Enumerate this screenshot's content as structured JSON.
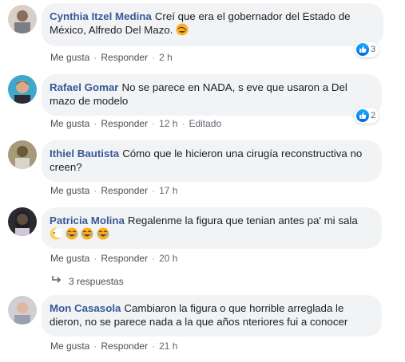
{
  "comments": [
    {
      "author": "Cynthia Itzel Medina",
      "text": "Creí que era el gobernador del Estado de México, Alfredo Del Mazo.",
      "like_label": "Me gusta",
      "reply_label": "Responder",
      "time": "2 h",
      "reaction_count": "3",
      "emojis": [
        "rofl-emoji"
      ]
    },
    {
      "author": "Rafael Gomar",
      "text": "No se parece en NADA, s eve que usaron a Del mazo de modelo",
      "like_label": "Me gusta",
      "reply_label": "Responder",
      "time": "12 h",
      "edited": "Editado",
      "reaction_count": "2"
    },
    {
      "author": "Ithiel Bautista",
      "text": "Cómo que le hicieron una cirugía reconstructiva no creen?",
      "like_label": "Me gusta",
      "reply_label": "Responder",
      "time": "17 h"
    },
    {
      "author": "Patricia Molina",
      "text": "Regalenme la figura que tenian antes pa' mi sala",
      "like_label": "Me gusta",
      "reply_label": "Responder",
      "time": "20 h",
      "emojis": [
        "moon-face-emoji",
        "joy-emoji",
        "joy-emoji",
        "joy-emoji"
      ]
    },
    {
      "author": "Mon Casasola",
      "text": "Cambiaron la figura o que horrible arreglada le dieron, no se parece nada a la que años nteriores fui a conocer",
      "like_label": "Me gusta",
      "reply_label": "Responder",
      "time": "21 h"
    }
  ],
  "replies_link": "3 respuestas",
  "colors": {
    "author": "#385898",
    "bubble": "#f2f3f5",
    "meta": "#606770",
    "like_blue": "#1877f2"
  }
}
